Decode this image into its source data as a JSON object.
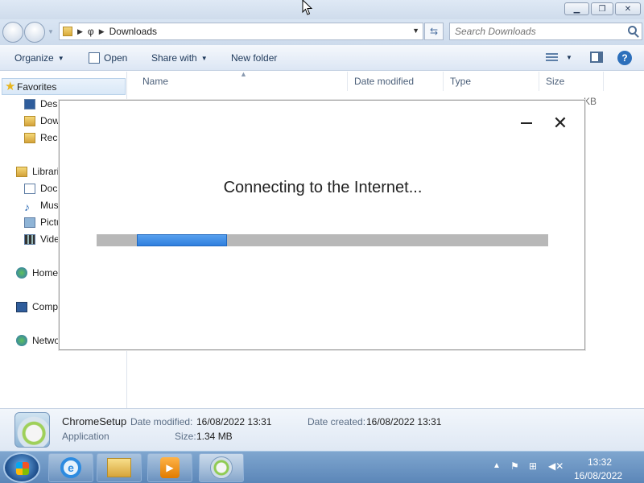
{
  "window": {
    "minimize_glyph": "▁",
    "maximize_glyph": "❐",
    "close_glyph": "✕"
  },
  "address": {
    "path": [
      "φ",
      "Downloads"
    ],
    "search_placeholder": "Search Downloads"
  },
  "toolbar": {
    "organize": "Organize",
    "open": "Open",
    "share_with": "Share with",
    "new_folder": "New folder"
  },
  "navigation": {
    "favorites": "Favorites",
    "desktop": "Desktop",
    "downloads": "Downloads",
    "recent": "Recent Places",
    "libraries": "Libraries",
    "documents": "Documents",
    "music": "Music",
    "pictures": "Pictures",
    "videos": "Videos",
    "homegroup": "Homegroup",
    "computer": "Computer",
    "network": "Network"
  },
  "columns": [
    "Name",
    "Date modified",
    "Type",
    "Size"
  ],
  "file_size_peek": "KB",
  "details": {
    "name": "ChromeSetup",
    "type": "Application",
    "date_modified_label": "Date modified:",
    "date_modified": "16/08/2022 13:31",
    "date_created_label": "Date created:",
    "date_created": "16/08/2022 13:31",
    "size_label": "Size:",
    "size": "1.34 MB"
  },
  "installer": {
    "message": "Connecting to the Internet...",
    "close_glyph": "✕",
    "progress_start_fraction": 0.09,
    "progress_end_fraction": 0.29
  },
  "taskbar": {
    "time": "13:32",
    "date": "16/08/2022"
  },
  "colors": {
    "progress_fill": "#2f7fde",
    "progress_track": "#b8b8b8",
    "taskbar": "#5b86b8"
  }
}
